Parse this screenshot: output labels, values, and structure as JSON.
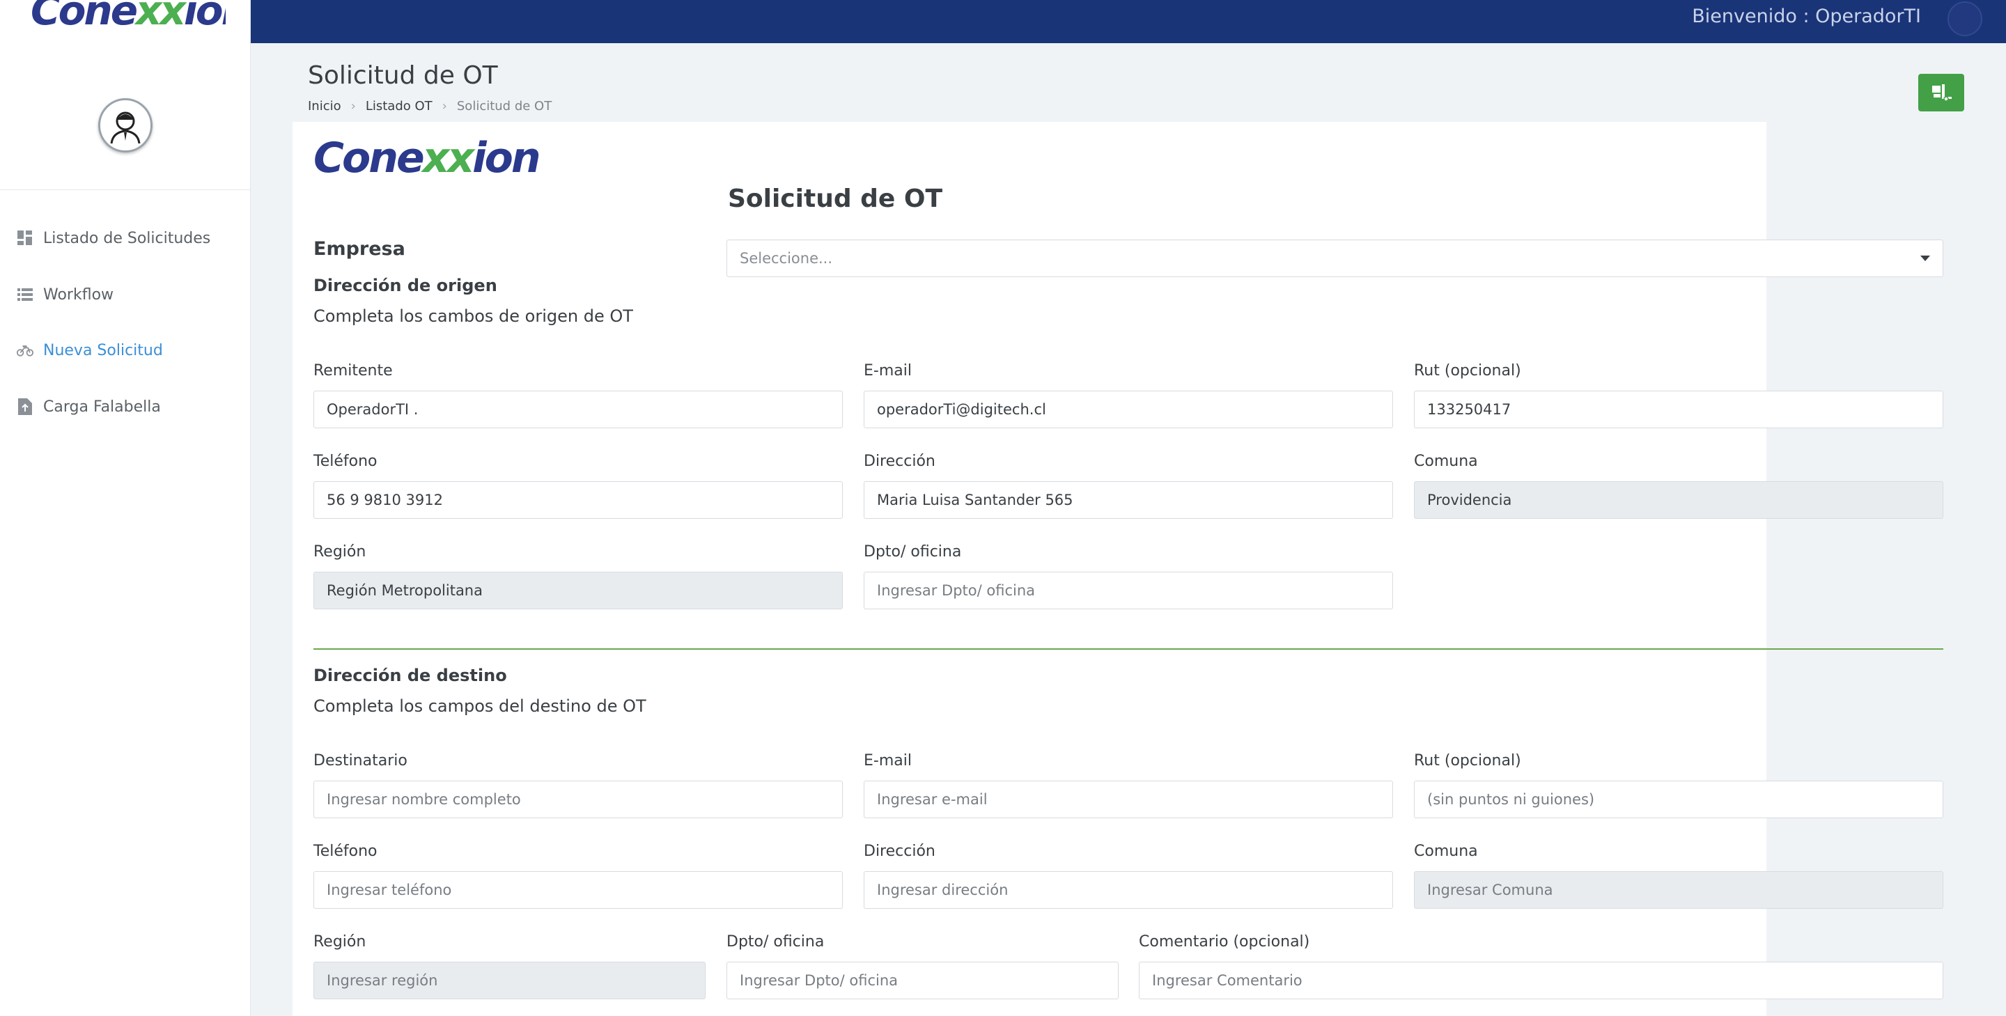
{
  "app": {
    "logo_text_a": "Cone",
    "logo_text_xx": "xx",
    "logo_text_b": "ion"
  },
  "header": {
    "welcome": "Bienvenido : OperadorTI"
  },
  "sidebar": {
    "items": [
      {
        "label": "Listado de Solicitudes",
        "icon": "dashboard-icon"
      },
      {
        "label": "Workflow",
        "icon": "list-icon"
      },
      {
        "label": "Nueva Solicitud",
        "icon": "motorcycle-icon",
        "active": true
      },
      {
        "label": "Carga Falabella",
        "icon": "file-upload-icon"
      }
    ]
  },
  "page": {
    "title": "Solicitud de OT",
    "breadcrumb": [
      "Inicio",
      "Listado OT",
      "Solicitud de OT"
    ]
  },
  "form": {
    "title": "Solicitud de OT",
    "empresa_label": "Empresa",
    "empresa_select": "Seleccione...",
    "origen": {
      "title": "Dirección de origen",
      "subtitle": "Completa los cambos de origen de OT",
      "remitente_label": "Remitente",
      "remitente_value": "OperadorTI .",
      "email_label": "E-mail",
      "email_value": "operadorTi@digitech.cl",
      "rut_label": "Rut (opcional)",
      "rut_value": "133250417",
      "telefono_label": "Teléfono",
      "telefono_value": "56 9 9810 3912",
      "direccion_label": "Dirección",
      "direccion_value": "Maria Luisa Santander 565",
      "comuna_label": "Comuna",
      "comuna_value": "Providencia",
      "region_label": "Región",
      "region_value": "Región Metropolitana",
      "dpto_label": "Dpto/ oficina",
      "dpto_placeholder": "Ingresar Dpto/ oficina"
    },
    "destino": {
      "title": "Dirección de destino",
      "subtitle": "Completa los campos del destino de OT",
      "destinatario_label": "Destinatario",
      "destinatario_placeholder": "Ingresar nombre completo",
      "email_label": "E-mail",
      "email_placeholder": "Ingresar e-mail",
      "rut_label": "Rut (opcional)",
      "rut_placeholder": "(sin puntos ni guiones)",
      "telefono_label": "Teléfono",
      "telefono_placeholder": "Ingresar teléfono",
      "direccion_label": "Dirección",
      "direccion_placeholder": "Ingresar dirección",
      "comuna_label": "Comuna",
      "comuna_placeholder": "Ingresar Comuna",
      "region_label": "Región",
      "region_placeholder": "Ingresar región",
      "dpto_label": "Dpto/ oficina",
      "dpto_placeholder": "Ingresar Dpto/ oficina",
      "comentario_label": "Comentario (opcional)",
      "comentario_placeholder": "Ingresar Comentario"
    }
  },
  "colors": {
    "topbar": "#1a3478",
    "accent_green": "#43a047",
    "active_link": "#3b8fd6"
  }
}
